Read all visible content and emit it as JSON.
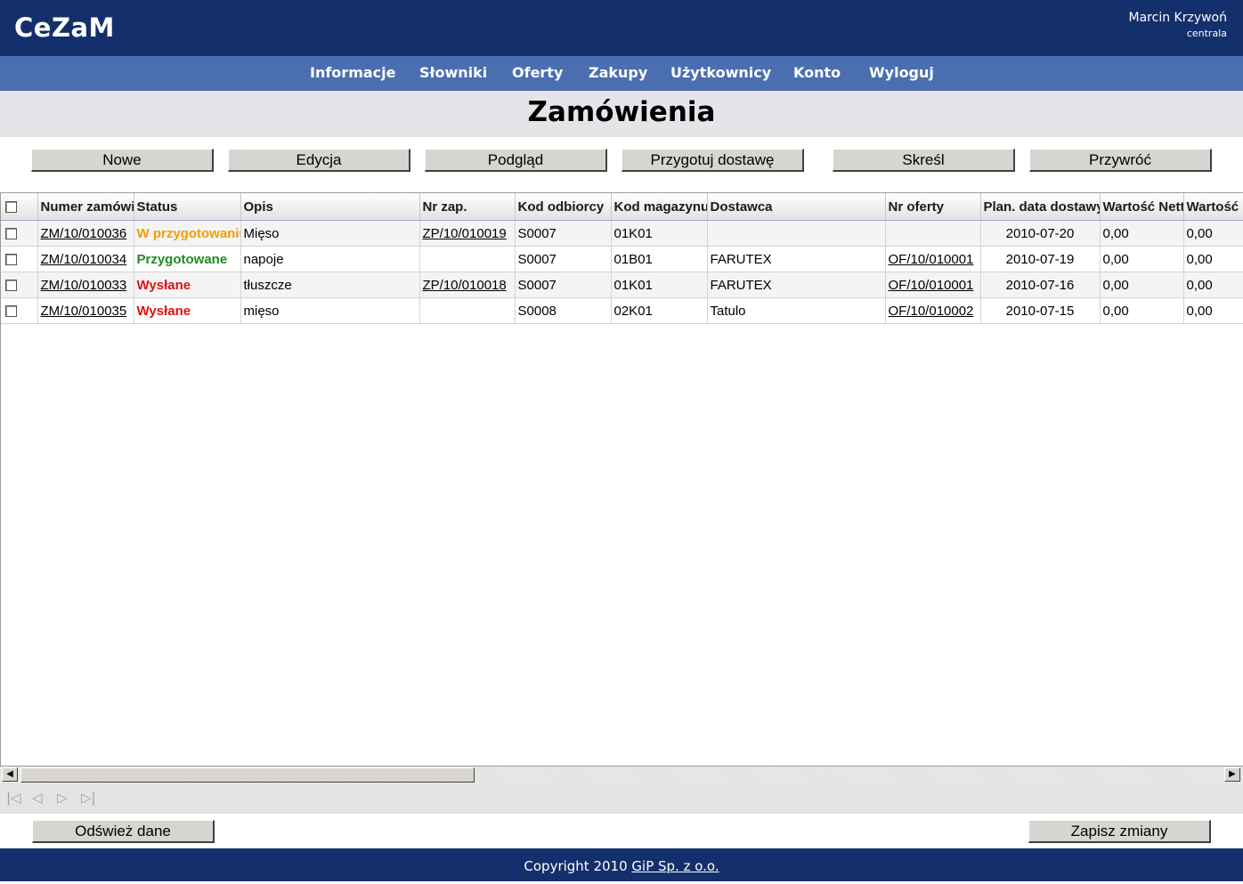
{
  "header": {
    "logo": "CeZaM",
    "user_name": "Marcin Krzywoń",
    "user_location": "centrala"
  },
  "nav": {
    "items": [
      "Informacje",
      "Słowniki",
      "Oferty",
      "Zakupy",
      "Użytkownicy",
      "Konto",
      "Wyloguj"
    ]
  },
  "page_title": "Zamówienia",
  "toolbar": {
    "new": "Nowe",
    "edit": "Edycja",
    "preview": "Podgląd",
    "prepare_delivery": "Przygotuj dostawę",
    "delete": "Skreśl",
    "restore": "Przywróć"
  },
  "table": {
    "headers": [
      "Numer zamówienia",
      "Status",
      "Opis",
      "Nr zap.",
      "Kod odbiorcy",
      "Kod magazynu",
      "Dostawca",
      "Nr oferty",
      "Plan. data dostawy",
      "Wartość Netto",
      "Wartość"
    ],
    "rows": [
      [
        "ZM/10/010036",
        "W przygotowaniu",
        "Mięso",
        "ZP/10/010019",
        "S0007",
        "01K01",
        "",
        "",
        "2010-07-20",
        "0,00",
        "0,00"
      ],
      [
        "ZM/10/010034",
        "Przygotowane",
        "napoje",
        "",
        "S0007",
        "01B01",
        "FARUTEX",
        "OF/10/010001",
        "2010-07-19",
        "0,00",
        "0,00"
      ],
      [
        "ZM/10/010033",
        "Wysłane",
        "tłuszcze",
        "ZP/10/010018",
        "S0007",
        "01K01",
        "FARUTEX",
        "OF/10/010001",
        "2010-07-16",
        "0,00",
        "0,00"
      ],
      [
        "ZM/10/010035",
        "Wysłane",
        "mięso",
        "",
        "S0008",
        "02K01",
        "Tatulo",
        "OF/10/010002",
        "2010-07-15",
        "0,00",
        "0,00"
      ]
    ],
    "status_colors": {
      "W przygotowaniu": "#f0a000",
      "Przygotowane": "#1f8a1f",
      "Wysłane": "#e01010"
    }
  },
  "pager_icons": [
    "first-page-icon",
    "prev-page-icon",
    "next-page-icon",
    "last-page-icon"
  ],
  "pager": {
    "first": "|◁",
    "prev": "◁",
    "next": "▷",
    "last": "▷|"
  },
  "bottom": {
    "refresh": "Odśwież dane",
    "save": "Zapisz zmiany"
  },
  "footer": {
    "text": "Copyright 2010 ",
    "link": "GiP Sp. z o.o."
  }
}
